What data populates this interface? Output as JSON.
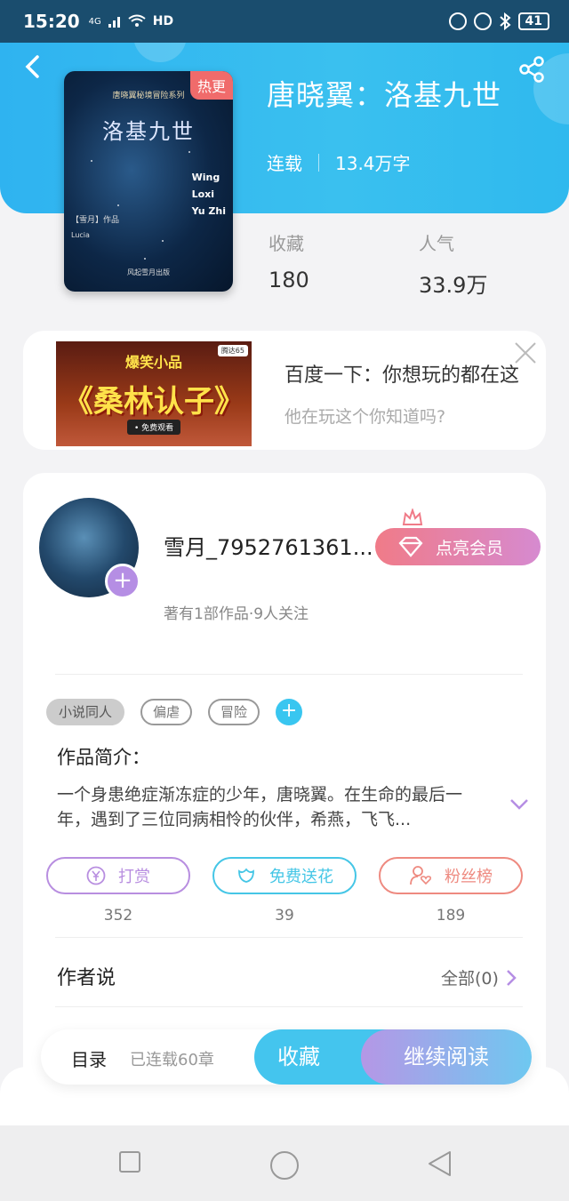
{
  "status_bar": {
    "time": "15:20",
    "net_label": "4G",
    "hd_label": "HD",
    "battery": "41"
  },
  "book": {
    "title": "唐晓翼：洛基九世",
    "status": "连载",
    "word_count": "13.4万字",
    "badge": "热更",
    "cover": {
      "series": "唐晓翼秘境冒险系列",
      "title": "洛基九世",
      "english": [
        "Wing",
        "Loxi",
        "Yu Zhi"
      ],
      "author": "【雪月】作品",
      "author2": "Lucia",
      "publisher": "风起雪月出版"
    }
  },
  "stats": {
    "favorites_label": "收藏",
    "favorites_value": "180",
    "popularity_label": "人气",
    "popularity_value": "33.9万"
  },
  "ad": {
    "thumb_top": "爆笑小品",
    "thumb_main": "《桑林认子》",
    "thumb_button": "• 免费观看",
    "thumb_tag": "腾达65",
    "title": "百度一下：你想玩的都在这",
    "subtitle": "他在玩这个你知道吗?"
  },
  "author": {
    "name": "雪月_7952761361...",
    "info": "著有1部作品·9人关注",
    "vip_label": "点亮会员"
  },
  "tags": [
    "小说同人",
    "偏虐",
    "冒险"
  ],
  "intro": {
    "label": "作品简介：",
    "text": "一个身患绝症渐冻症的少年，唐晓翼。在生命的最后一年，遇到了三位同病相怜的伙伴，希燕，飞飞..."
  },
  "actions": [
    {
      "label": "打赏",
      "count": "352",
      "color": "#b88ee0"
    },
    {
      "label": "免费送花",
      "count": "39",
      "color": "#45c6e6"
    },
    {
      "label": "粉丝榜",
      "count": "189",
      "color": "#ee8a80"
    }
  ],
  "author_say": {
    "label": "作者说",
    "all": "全部(0)"
  },
  "bottom_bar": {
    "toc": "目录",
    "toc_sub": "已连载60章",
    "favorite": "收藏",
    "continue_read": "继续阅读"
  },
  "colors": {
    "header": "#35baf0",
    "accent_blue": "#44c5ee",
    "accent_purple": "#b58ee4",
    "vip_pink": "#f07b88"
  }
}
